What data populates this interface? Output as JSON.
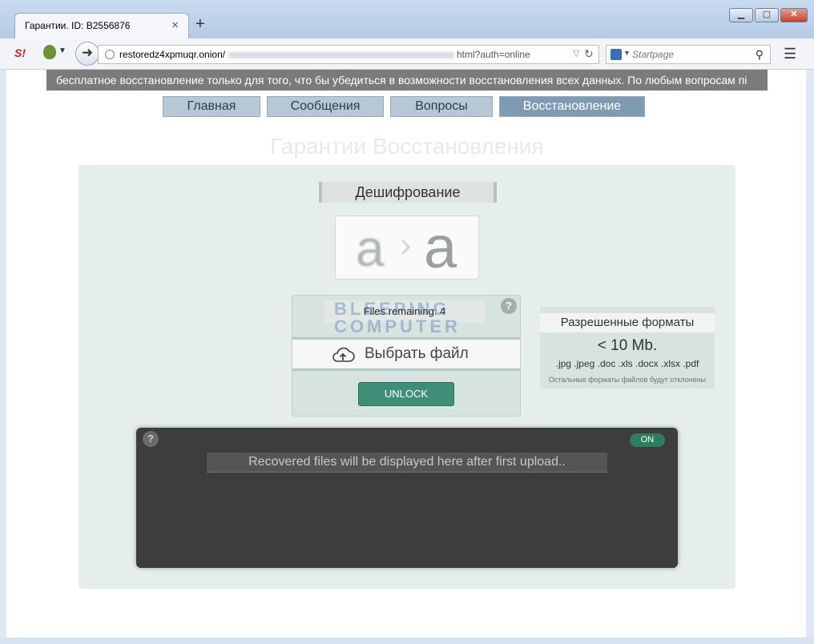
{
  "browser": {
    "tab_title": "Гарантии. ID: B2556876",
    "tab_close": "×",
    "new_tab": "+",
    "window_min": "▁",
    "window_max": "▢",
    "window_close": "✕",
    "url_host": "restoredz4xpmuqr.onion/",
    "url_path": "html?auth=online",
    "search_placeholder": "Startpage",
    "logo_text": "S!"
  },
  "banner": {
    "text": "бесплатное восстановление только для того, что бы убедиться в возможности восстановления всех данных. По любым вопросам пі"
  },
  "nav": {
    "tabs": [
      {
        "label": "Главная"
      },
      {
        "label": "Сообщения"
      },
      {
        "label": "Вопросы"
      },
      {
        "label": "Восстановление"
      }
    ],
    "active_index": 3
  },
  "page": {
    "title": "Гарантии Восстановления",
    "decrypt_label": "Дешифрование",
    "glyph_before": "a",
    "glyph_arrow": "›",
    "glyph_after": "a"
  },
  "upload": {
    "files_remaining_label": "Files remaining:",
    "files_remaining_count": "4",
    "watermark": "BLEEPING COMPUTER",
    "help": "?",
    "choose_file": "Выбрать файл",
    "unlock": "UNLOCK"
  },
  "formats": {
    "title": "Разрешенные форматы",
    "size": "< 10 Mb.",
    "extensions": ".jpg .jpeg .doc .xls .docx .xlsx .pdf",
    "note": "Остальные форматы файлов будут отклонены"
  },
  "recovered": {
    "help": "?",
    "toggle": "ON",
    "message": "Recovered files will be displayed here after first upload.."
  },
  "colors": {
    "active_tab": "#7f9bb3",
    "unlock_button": "#3f8f78",
    "recovered_panel": "#3d3d3d"
  }
}
